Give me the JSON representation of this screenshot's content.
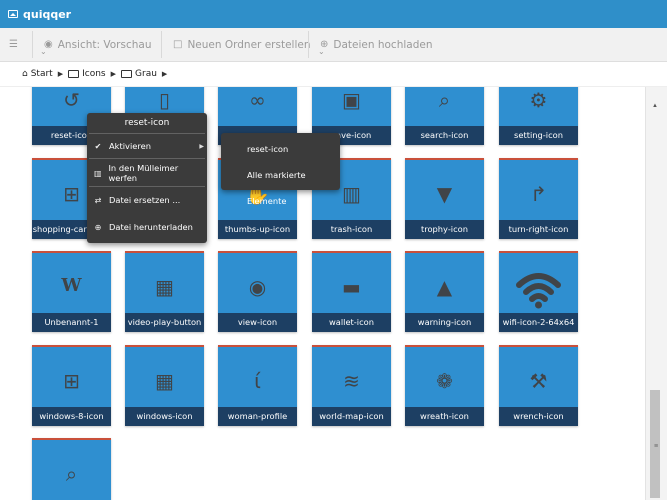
{
  "window": {
    "title": "quiqqer",
    "title_icon": "image-icon"
  },
  "toolbar": {
    "view_label": "Ansicht: Vorschau",
    "new_folder_label": "Neuen Ordner erstellen",
    "upload_label": "Dateien hochladen"
  },
  "breadcrumb": [
    "Start",
    "Icons",
    "Grau"
  ],
  "tiles": [
    {
      "label": "reset-icon",
      "icon": "reset-icon"
    },
    {
      "label": "",
      "icon": "mobile-icon"
    },
    {
      "label": "",
      "icon": "glasses-icon"
    },
    {
      "label": "save-icon",
      "icon": "save-icon"
    },
    {
      "label": "search-icon",
      "icon": "search-icon"
    },
    {
      "label": "setting-icon",
      "icon": "gear-icon"
    },
    {
      "label": "shopping-cart-icon",
      "icon": "cart-icon"
    },
    {
      "label": "",
      "icon": "speaker-icon"
    },
    {
      "label": "thumbs-up-icon",
      "icon": "thumbs-up-icon"
    },
    {
      "label": "trash-icon",
      "icon": "trash-icon"
    },
    {
      "label": "trophy-icon",
      "icon": "trophy-icon"
    },
    {
      "label": "turn-right-icon",
      "icon": "turn-right-icon"
    },
    {
      "label": "Unbenannt-1",
      "icon": "w-letter-icon"
    },
    {
      "label": "video-play-button",
      "icon": "film-icon"
    },
    {
      "label": "view-icon",
      "icon": "eye-icon"
    },
    {
      "label": "wallet-icon",
      "icon": "wallet-icon"
    },
    {
      "label": "warning-icon",
      "icon": "warning-icon"
    },
    {
      "label": "wifi-icon-2-64x64",
      "icon": "wifi-icon"
    },
    {
      "label": "windows-8-icon",
      "icon": "windows8-icon"
    },
    {
      "label": "windows-icon",
      "icon": "windows-icon"
    },
    {
      "label": "woman-profile",
      "icon": "woman-profile-icon"
    },
    {
      "label": "world-map-icon",
      "icon": "world-map-icon"
    },
    {
      "label": "wreath-icon",
      "icon": "wreath-icon"
    },
    {
      "label": "wrench-icon",
      "icon": "wrench-icon"
    },
    {
      "label": "",
      "icon": "zoom-icon"
    }
  ],
  "context_menu": {
    "title": "reset-icon",
    "items": [
      {
        "label": "Aktivieren",
        "icon": "check-icon"
      },
      {
        "label": "In den Mülleimer werfen",
        "icon": "trash-icon"
      },
      {
        "label": "Datei ersetzen ...",
        "icon": "exchange-icon"
      },
      {
        "label": "Datei herunterladen",
        "icon": "download-icon"
      }
    ],
    "submenu": [
      "reset-icon",
      "Alle markierte Elemente"
    ]
  },
  "colors": {
    "titlebar": "#2f8fc9",
    "tile": "#2f8fd0",
    "tile_label": "#1d3f63",
    "tile_accent": "#c9503b",
    "menu": "#3b3b3b"
  }
}
